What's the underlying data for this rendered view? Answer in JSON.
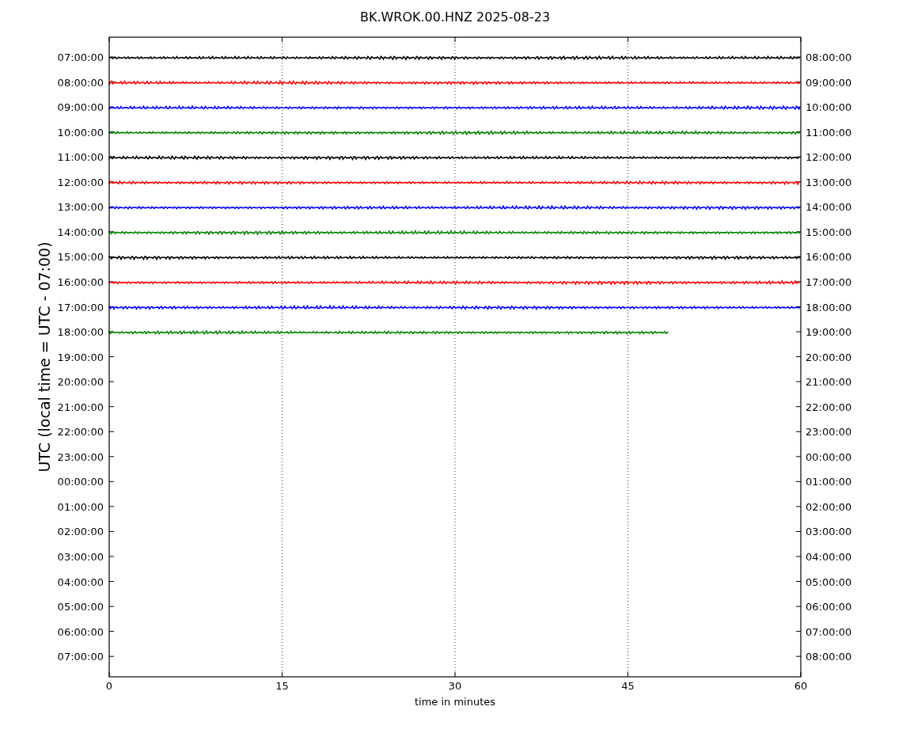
{
  "title": "BK.WROK.00.HNZ 2025-08-23",
  "ylabel": "UTC (local time = UTC - 07:00)",
  "xlabel": "time in minutes",
  "xticks": [
    "0",
    "15",
    "30",
    "45",
    "60"
  ],
  "left_ticks": [
    "07:00:00",
    "08:00:00",
    "09:00:00",
    "10:00:00",
    "11:00:00",
    "12:00:00",
    "13:00:00",
    "14:00:00",
    "15:00:00",
    "16:00:00",
    "17:00:00",
    "18:00:00",
    "19:00:00",
    "20:00:00",
    "21:00:00",
    "22:00:00",
    "23:00:00",
    "00:00:00",
    "01:00:00",
    "02:00:00",
    "03:00:00",
    "04:00:00",
    "05:00:00",
    "06:00:00",
    "07:00:00"
  ],
  "right_ticks": [
    "08:00:00",
    "09:00:00",
    "10:00:00",
    "11:00:00",
    "12:00:00",
    "13:00:00",
    "14:00:00",
    "15:00:00",
    "16:00:00",
    "17:00:00",
    "18:00:00",
    "19:00:00",
    "20:00:00",
    "21:00:00",
    "22:00:00",
    "23:00:00",
    "00:00:00",
    "01:00:00",
    "02:00:00",
    "03:00:00",
    "04:00:00",
    "05:00:00",
    "06:00:00",
    "07:00:00",
    "08:00:00"
  ],
  "traces": [
    {
      "color": "#000000",
      "level": 1
    },
    {
      "color": "#ff0000",
      "level": 1
    },
    {
      "color": "#0000ff",
      "level": 1
    },
    {
      "color": "#008000",
      "level": 1
    },
    {
      "color": "#000000",
      "level": 1
    },
    {
      "color": "#ff0000",
      "level": 1
    },
    {
      "color": "#0000ff",
      "level": 1
    },
    {
      "color": "#008000",
      "level": 1
    },
    {
      "color": "#000000",
      "level": 1
    },
    {
      "color": "#ff0000",
      "level": 1
    },
    {
      "color": "#0000ff",
      "level": 1
    },
    {
      "color": "#008000",
      "level": 0.81
    }
  ]
}
